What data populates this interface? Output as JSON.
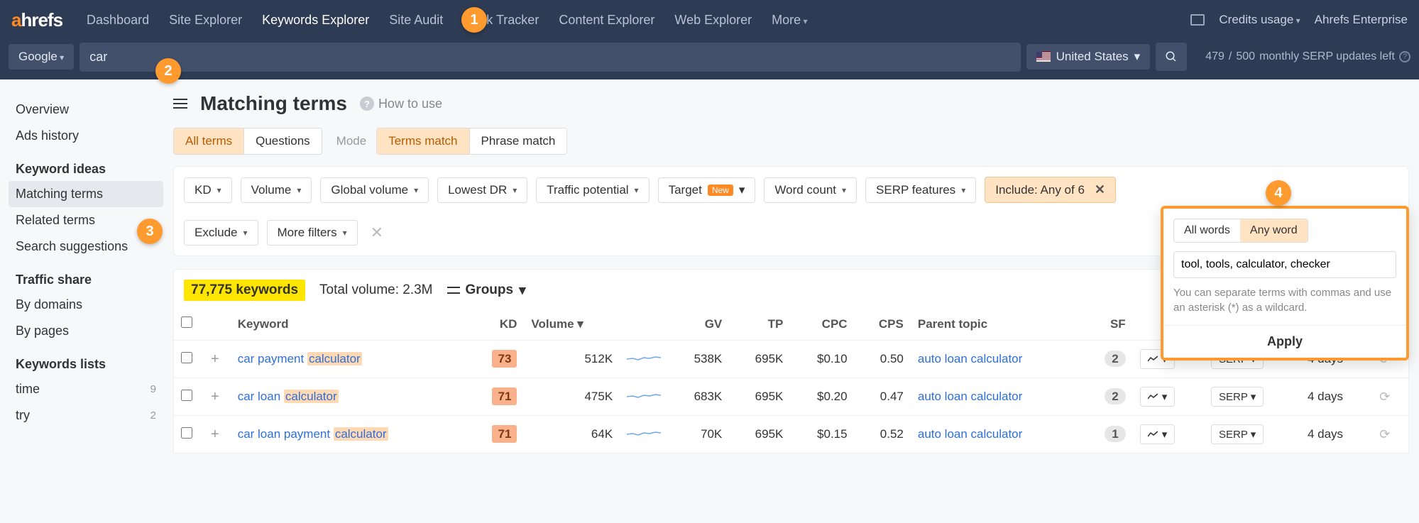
{
  "nav": {
    "logo_a": "a",
    "logo_rest": "hrefs",
    "items": [
      "Dashboard",
      "Site Explorer",
      "Keywords Explorer",
      "Site Audit",
      "Rank Tracker",
      "Content Explorer",
      "Web Explorer",
      "More"
    ],
    "active_index": 2,
    "credits_usage": "Credits usage",
    "account": "Ahrefs Enterprise"
  },
  "search": {
    "engine": "Google",
    "query": "car",
    "country": "United States",
    "credits_used": "479",
    "credits_total": "500",
    "credits_label": "monthly SERP updates left"
  },
  "sidebar": {
    "items": [
      "Overview",
      "Ads history"
    ],
    "group1_title": "Keyword ideas",
    "group1": [
      "Matching terms",
      "Related terms",
      "Search suggestions"
    ],
    "group1_active": 0,
    "group2_title": "Traffic share",
    "group2": [
      "By domains",
      "By pages"
    ],
    "group3_title": "Keywords lists",
    "lists": [
      {
        "name": "time",
        "count": "9"
      },
      {
        "name": "try",
        "count": "2"
      }
    ]
  },
  "page": {
    "title": "Matching terms",
    "how_to_use": "How to use",
    "tabs1": [
      "All terms",
      "Questions"
    ],
    "tabs1_active": 0,
    "mode_label": "Mode",
    "tabs2": [
      "Terms match",
      "Phrase match"
    ],
    "tabs2_active": 0
  },
  "filters": {
    "chips": [
      "KD",
      "Volume",
      "Global volume",
      "Lowest DR",
      "Traffic potential",
      "Target",
      "Word count",
      "SERP features"
    ],
    "target_new": "New",
    "include_label": "Include: Any of 6",
    "exclude": "Exclude",
    "more": "More filters"
  },
  "popover": {
    "opt_all": "All words",
    "opt_any": "Any word",
    "input_value": "tool, tools, calculator, checker",
    "hint": "You can separate terms with commas and use an asterisk (*) as a wildcard.",
    "apply": "Apply"
  },
  "summary": {
    "kw_count": "77,775 keywords",
    "total_volume": "Total volume: 2.3M",
    "groups": "Groups"
  },
  "table": {
    "headers": {
      "keyword": "Keyword",
      "kd": "KD",
      "volume": "Volume",
      "gv": "GV",
      "tp": "TP",
      "cpc": "CPC",
      "cps": "CPS",
      "parent": "Parent topic",
      "sf": "SF"
    },
    "rows": [
      {
        "kw_pre": "car payment ",
        "kw_hl": "calculator",
        "kd": "73",
        "vol": "512K",
        "gv": "538K",
        "tp": "695K",
        "cpc": "$0.10",
        "cps": "0.50",
        "parent": "auto loan calculator",
        "sf": "2",
        "serp": "SERP",
        "updated": "4 days"
      },
      {
        "kw_pre": "car loan ",
        "kw_hl": "calculator",
        "kd": "71",
        "vol": "475K",
        "gv": "683K",
        "tp": "695K",
        "cpc": "$0.20",
        "cps": "0.47",
        "parent": "auto loan calculator",
        "sf": "2",
        "serp": "SERP",
        "updated": "4 days"
      },
      {
        "kw_pre": "car loan payment ",
        "kw_hl": "calculator",
        "kd": "71",
        "vol": "64K",
        "gv": "70K",
        "tp": "695K",
        "cpc": "$0.15",
        "cps": "0.52",
        "parent": "auto loan calculator",
        "sf": "1",
        "serp": "SERP",
        "updated": "4 days"
      }
    ]
  },
  "callouts": {
    "c1": "1",
    "c2": "2",
    "c3": "3",
    "c4": "4"
  }
}
